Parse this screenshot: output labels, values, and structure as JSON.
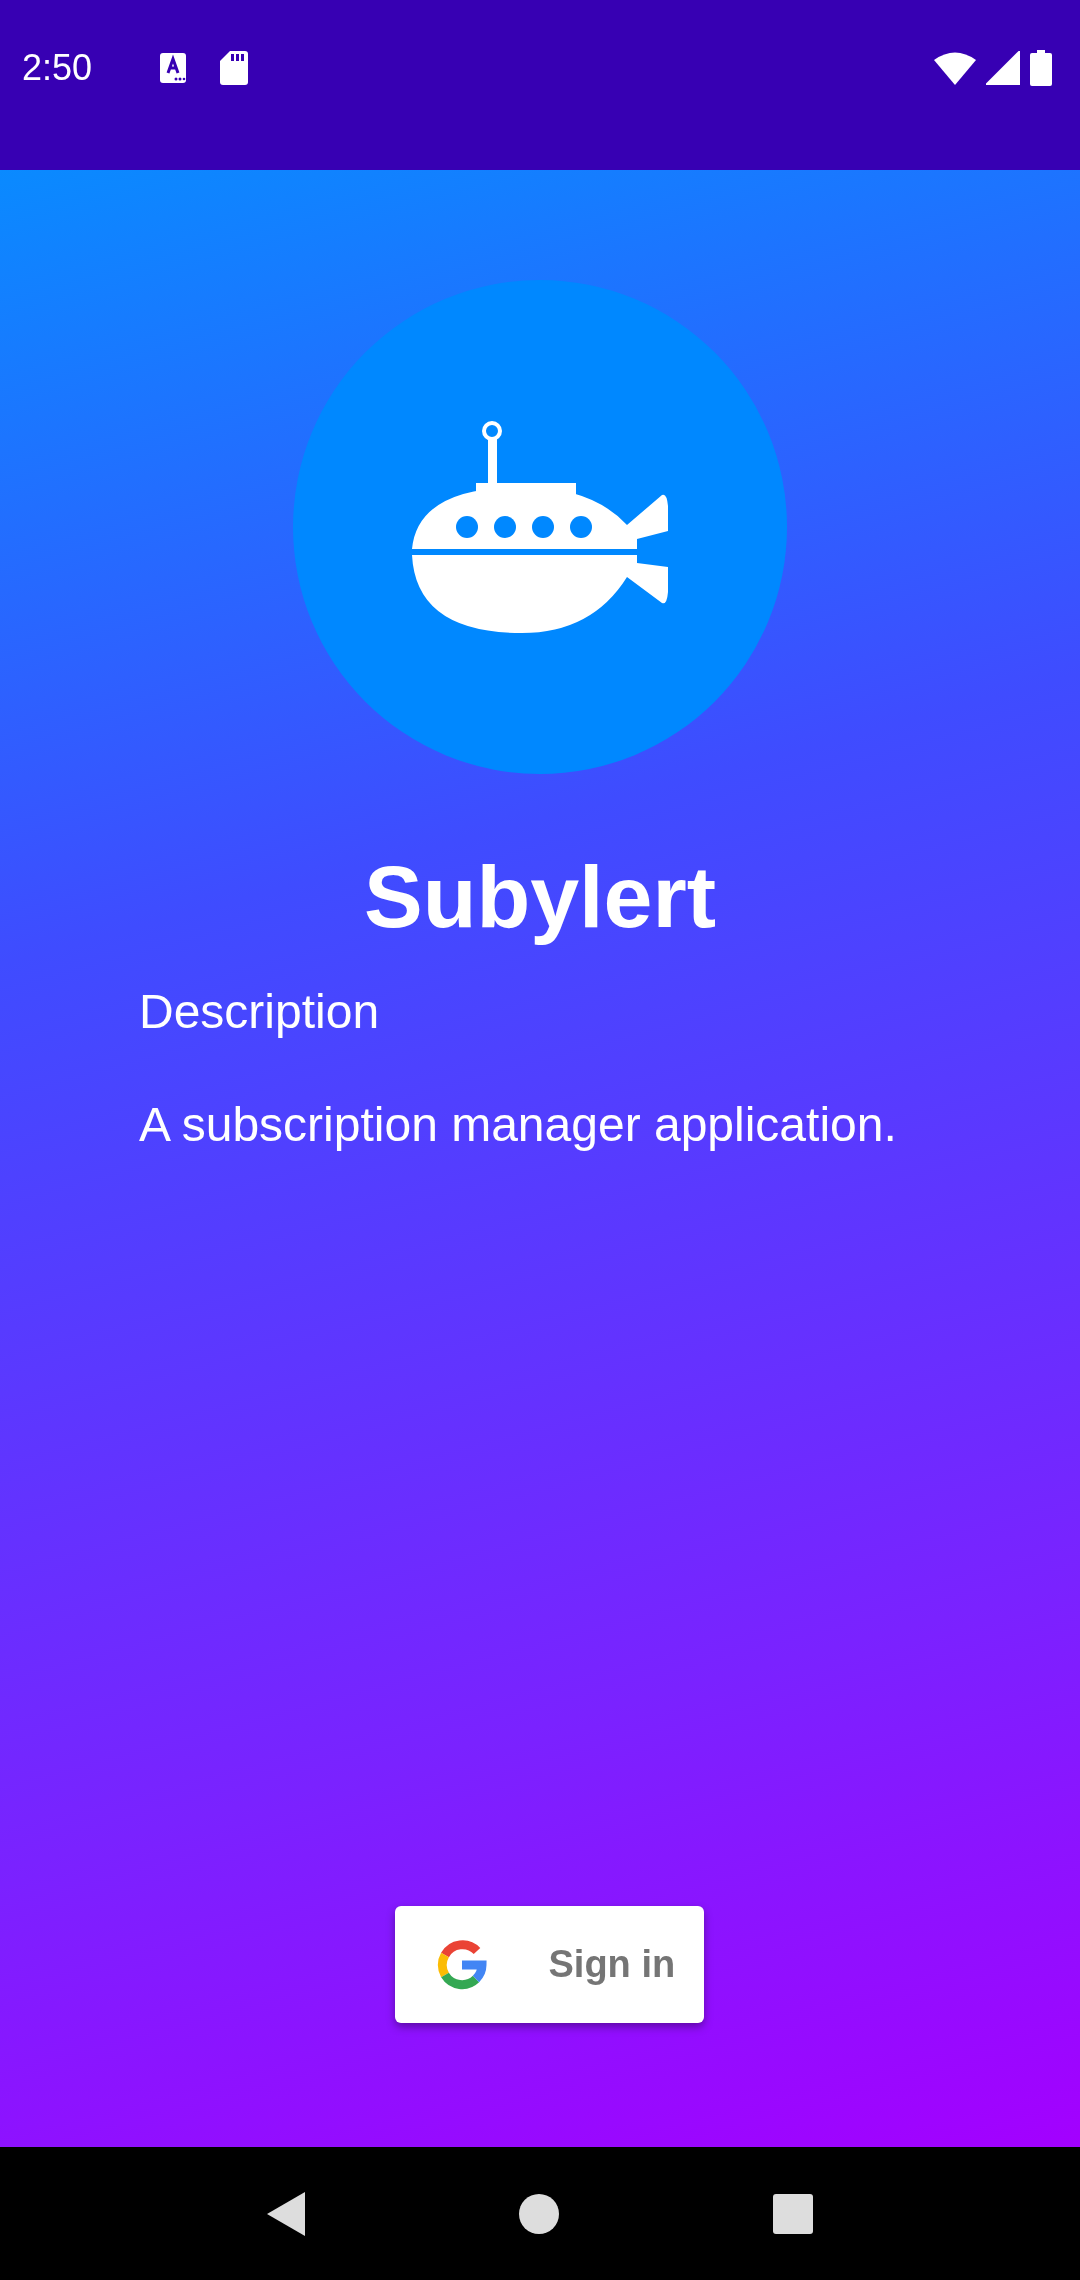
{
  "status_bar": {
    "time": "2:50"
  },
  "app": {
    "title": "Subylert",
    "description_label": "Description",
    "description": "A subscription manager application."
  },
  "sign_in_button": {
    "label": "Sign in"
  }
}
